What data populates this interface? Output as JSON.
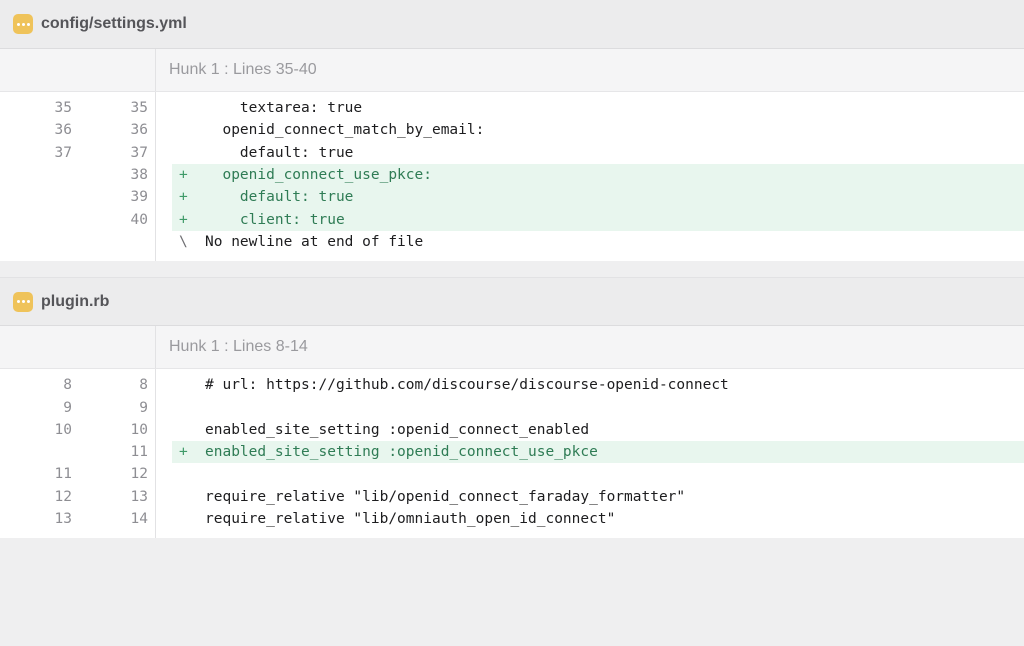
{
  "files": [
    {
      "name": "config/settings.yml",
      "hunk": "Hunk 1 : Lines 35-40",
      "lines": [
        {
          "old": "35",
          "new": "35",
          "marker": "",
          "text": "    textarea: true",
          "type": "ctx"
        },
        {
          "old": "36",
          "new": "36",
          "marker": "",
          "text": "  openid_connect_match_by_email:",
          "type": "ctx"
        },
        {
          "old": "37",
          "new": "37",
          "marker": "",
          "text": "    default: true",
          "type": "ctx"
        },
        {
          "old": "",
          "new": "38",
          "marker": "+",
          "text": "  openid_connect_use_pkce:",
          "type": "added"
        },
        {
          "old": "",
          "new": "39",
          "marker": "+",
          "text": "    default: true",
          "type": "added"
        },
        {
          "old": "",
          "new": "40",
          "marker": "+",
          "text": "    client: true",
          "type": "added"
        },
        {
          "old": "",
          "new": "",
          "marker": "\\",
          "text": "No newline at end of file",
          "type": "ctx"
        }
      ]
    },
    {
      "name": "plugin.rb",
      "hunk": "Hunk 1 : Lines 8-14",
      "lines": [
        {
          "old": "8",
          "new": "8",
          "marker": "",
          "text": "# url: https://github.com/discourse/discourse-openid-connect",
          "type": "ctx"
        },
        {
          "old": "9",
          "new": "9",
          "marker": "",
          "text": "",
          "type": "ctx"
        },
        {
          "old": "10",
          "new": "10",
          "marker": "",
          "text": "enabled_site_setting :openid_connect_enabled",
          "type": "ctx"
        },
        {
          "old": "",
          "new": "11",
          "marker": "+",
          "text": "enabled_site_setting :openid_connect_use_pkce",
          "type": "added"
        },
        {
          "old": "11",
          "new": "12",
          "marker": "",
          "text": "",
          "type": "ctx"
        },
        {
          "old": "12",
          "new": "13",
          "marker": "",
          "text": "require_relative \"lib/openid_connect_faraday_formatter\"",
          "type": "ctx"
        },
        {
          "old": "13",
          "new": "14",
          "marker": "",
          "text": "require_relative \"lib/omniauth_open_id_connect\"",
          "type": "ctx"
        }
      ]
    }
  ],
  "colors": {
    "added_bg": "#e8f6ee",
    "added_text": "#2f7c55",
    "file_icon": "#efc35a"
  },
  "icons": [
    "file-icon"
  ]
}
